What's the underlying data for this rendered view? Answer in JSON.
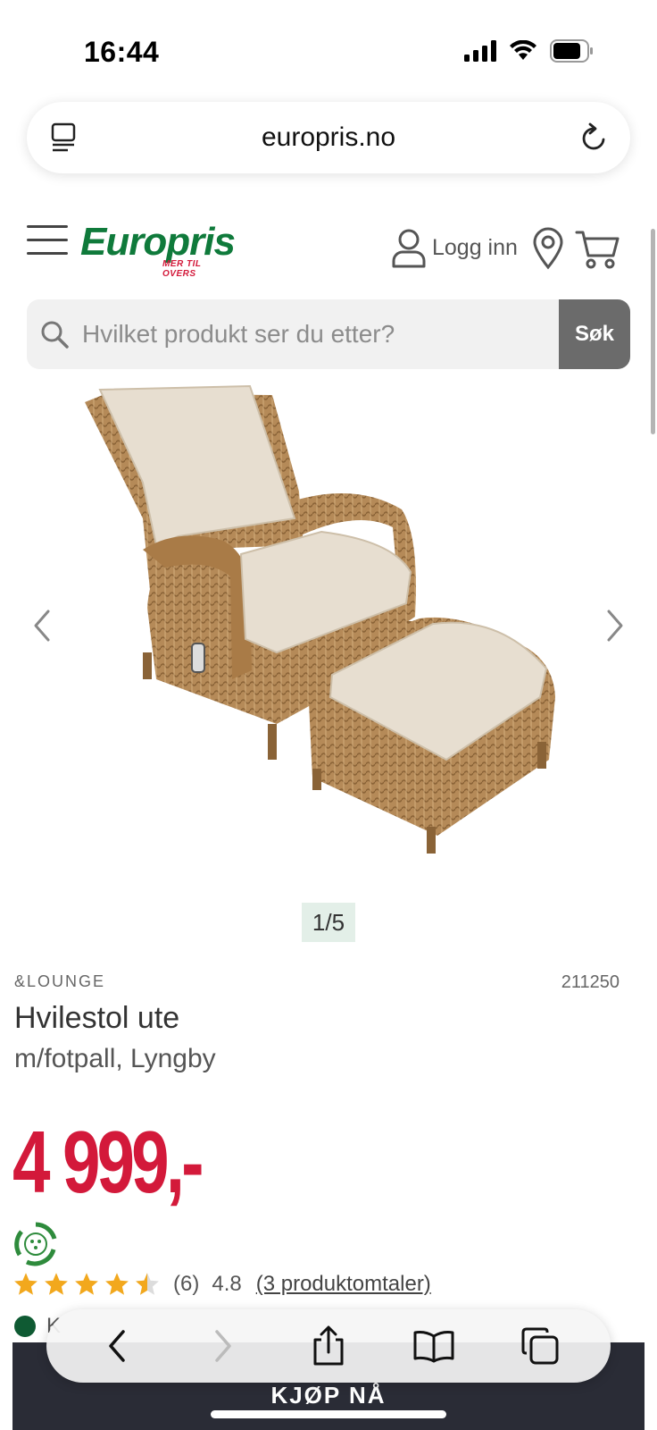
{
  "status_bar": {
    "time": "16:44"
  },
  "browser": {
    "url": "europris.no"
  },
  "header": {
    "logo_text": "Europris",
    "logo_tagline": "MER TIL OVERS",
    "login_label": "Logg inn"
  },
  "search": {
    "placeholder": "Hvilket produkt ser du etter?",
    "button_label": "Søk"
  },
  "gallery": {
    "pager": "1/5"
  },
  "product": {
    "brand": "&LOUNGE",
    "sku": "211250",
    "title": "Hvilestol ute",
    "subtitle": "m/fotpall, Lyngby",
    "price": "4 999,-",
    "rating_count": "(6)",
    "rating_score": "4.8",
    "rating_value": 4.8,
    "reviews_link": "(3 produktomtaler)",
    "stock_text": "K",
    "buy_label": "KJØP NÅ"
  },
  "colors": {
    "brand_green": "#0f7a3b",
    "price_red": "#d3193a",
    "star_gold": "#f2a81d",
    "buy_button": "#2a2c36"
  }
}
